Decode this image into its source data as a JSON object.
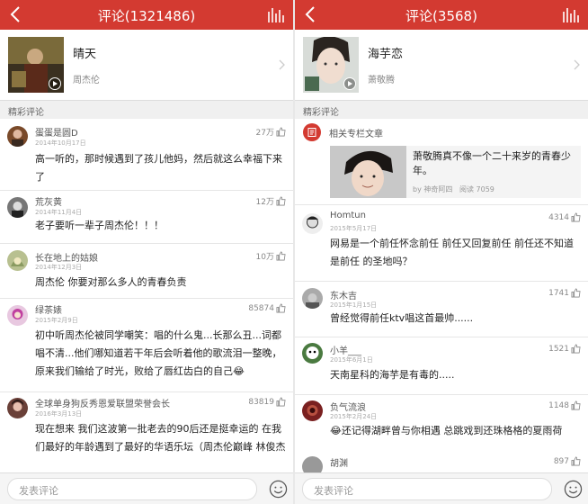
{
  "left": {
    "header": {
      "title": "评论(1321486)"
    },
    "song": {
      "name": "晴天",
      "artist": "周杰伦"
    },
    "section_label": "精彩评论",
    "comments": [
      {
        "user": "蛋蛋是圆D",
        "date": "2014年10月17日",
        "likes": "27万",
        "text": "高一听的，那时候遇到了孩儿他妈，然后就这么幸福下来了"
      },
      {
        "user": "荒灰黄",
        "date": "2014年11月4日",
        "likes": "12万",
        "text": "老子要听一辈子周杰伦！！！"
      },
      {
        "user": "长在地上的姑娘",
        "date": "2014年12月3日",
        "likes": "10万",
        "text": "周杰伦 你要对那么多人的青春负责"
      },
      {
        "user": "绿茶婊",
        "date": "2015年2月9日",
        "likes": "85874",
        "text": "初中听周杰伦被同学嘲笑：唱的什么鬼...长那么丑...词都唱不清...他们哪知道若干年后会听着他的歌流泪一整晚，原来我们输给了时光，败给了唇红齿白的自己😂"
      },
      {
        "user": "全球单身狗反秀恩爱联盟荣誉会长",
        "date": "2016年3月13日",
        "likes": "83819",
        "text": "现在想来 我们这波第一批老去的90后还是挺幸运的 在我们最好的年龄遇到了最好的华语乐坛（周杰伦巅峰 林俊杰"
      }
    ],
    "input_placeholder": "发表评论"
  },
  "right": {
    "header": {
      "title": "评论(3568)"
    },
    "song": {
      "name": "海芋恋",
      "artist": "萧敬腾"
    },
    "section_label": "精彩评论",
    "article": {
      "label": "相关专栏文章",
      "title": "萧敬腾真不像一个二十来岁的青春少年。",
      "author": "by 神奇阿四",
      "reads": "阅读 7059"
    },
    "comments": [
      {
        "user": "Homtun",
        "date": "2015年5月17日",
        "likes": "4314",
        "text": "网易是一个前任怀念前任 前任又回复前任 前任还不知道是前任 的圣地吗？"
      },
      {
        "user": "东木吉",
        "date": "2015年1月15日",
        "likes": "1741",
        "text": "曾经觉得前任ktv唱这首最帅......"
      },
      {
        "user": "小羊___",
        "date": "2015年6月1日",
        "likes": "1521",
        "text": "天南星科的海芋是有毒的....."
      },
      {
        "user": "负气流浪",
        "date": "2015年2月24日",
        "likes": "1148",
        "text": "😂还记得湖畔曾与你相遇 总跳戏到还珠格格的夏雨荷"
      },
      {
        "user": "胡渊",
        "date": "",
        "likes": "897",
        "text": ""
      }
    ],
    "input_placeholder": "发表评论"
  },
  "colors": {
    "accent": "#d33a31",
    "background": "#ffffff",
    "divider": "#e6e6e6"
  },
  "icons": [
    "back-arrow-icon",
    "equalizer-icon",
    "play-icon",
    "chevron-right-icon",
    "thumbs-up-icon",
    "emoji-icon",
    "article-icon"
  ]
}
